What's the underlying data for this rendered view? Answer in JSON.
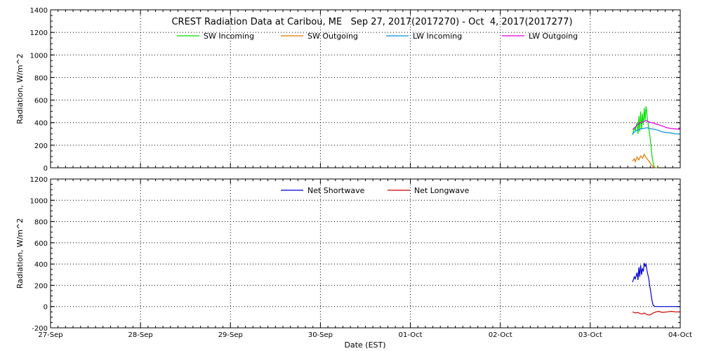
{
  "title": "CREST Radiation Data at Caribou, ME   Sep 27, 2017(2017270) - Oct  4, 2017(2017277)",
  "xlabel": "Date (EST)",
  "x_ticks": [
    "27-Sep",
    "28-Sep",
    "29-Sep",
    "30-Sep",
    "01-Oct",
    "02-Oct",
    "03-Oct",
    "04-Oct"
  ],
  "colors": {
    "sw_in": "#00dd00",
    "sw_out": "#e07800",
    "lw_in": "#0090e0",
    "lw_out": "#e000e0",
    "net_sw": "#0000cc",
    "net_lw": "#cc0000"
  },
  "chart_data": [
    {
      "type": "line",
      "ylabel": "Radiation, W/m^2",
      "ylim": [
        0,
        1400
      ],
      "y_ticks": [
        0,
        200,
        400,
        600,
        800,
        1000,
        1200,
        1400
      ],
      "xlim_days": [
        0,
        7
      ],
      "grid": true,
      "legend": "top",
      "series": [
        {
          "name": "SW Incoming",
          "color_key": "sw_in",
          "x": [
            6.47,
            6.49,
            6.5,
            6.52,
            6.53,
            6.54,
            6.55,
            6.56,
            6.57,
            6.58,
            6.59,
            6.6,
            6.61,
            6.62,
            6.63,
            6.64,
            6.65,
            6.66,
            6.67,
            6.68,
            6.69,
            6.7,
            6.71,
            6.72,
            6.73,
            6.74,
            6.75
          ],
          "values": [
            290,
            360,
            330,
            400,
            300,
            460,
            320,
            500,
            340,
            480,
            380,
            530,
            420,
            545,
            470,
            400,
            350,
            300,
            230,
            150,
            80,
            40,
            10,
            5,
            0,
            0,
            0
          ]
        },
        {
          "name": "SW Outgoing",
          "color_key": "sw_out",
          "x": [
            6.47,
            6.49,
            6.5,
            6.52,
            6.54,
            6.56,
            6.58,
            6.6,
            6.62,
            6.64,
            6.66,
            6.68,
            6.7,
            6.72,
            6.74
          ],
          "values": [
            60,
            80,
            55,
            95,
            70,
            105,
            85,
            120,
            90,
            70,
            50,
            25,
            10,
            0,
            0
          ]
        },
        {
          "name": "LW Incoming",
          "color_key": "lw_in",
          "x": [
            6.47,
            6.5,
            6.53,
            6.56,
            6.6,
            6.63,
            6.66,
            6.7,
            6.73,
            6.76,
            6.8,
            6.85,
            6.9,
            6.95,
            7.0
          ],
          "values": [
            300,
            325,
            335,
            345,
            350,
            355,
            348,
            342,
            340,
            330,
            318,
            312,
            308,
            300,
            300
          ]
        },
        {
          "name": "LW Outgoing",
          "color_key": "lw_out",
          "x": [
            6.47,
            6.49,
            6.5,
            6.52,
            6.54,
            6.56,
            6.58,
            6.6,
            6.62,
            6.64,
            6.66,
            6.68,
            6.7,
            6.72,
            6.75,
            6.78,
            6.8,
            6.85,
            6.9,
            6.95,
            7.0
          ],
          "values": [
            340,
            350,
            360,
            380,
            390,
            400,
            405,
            410,
            420,
            410,
            405,
            398,
            398,
            390,
            385,
            375,
            370,
            355,
            348,
            345,
            340
          ]
        }
      ]
    },
    {
      "type": "line",
      "ylabel": "Radiation, W/m^2",
      "ylim": [
        -200,
        1200
      ],
      "y_ticks": [
        -200,
        0,
        200,
        400,
        600,
        800,
        1000,
        1200
      ],
      "xlim_days": [
        0,
        7
      ],
      "grid": true,
      "legend": "top",
      "series": [
        {
          "name": "Net Shortwave",
          "color_key": "net_sw",
          "x": [
            6.47,
            6.49,
            6.5,
            6.52,
            6.53,
            6.54,
            6.55,
            6.56,
            6.57,
            6.58,
            6.59,
            6.6,
            6.61,
            6.62,
            6.63,
            6.64,
            6.65,
            6.66,
            6.67,
            6.68,
            6.69,
            6.7,
            6.72,
            6.75,
            6.8,
            6.9,
            7.0
          ],
          "values": [
            230,
            280,
            260,
            320,
            250,
            370,
            280,
            390,
            300,
            360,
            330,
            410,
            380,
            400,
            340,
            300,
            260,
            200,
            150,
            90,
            40,
            10,
            0,
            0,
            0,
            0,
            0
          ]
        },
        {
          "name": "Net Longwave",
          "color_key": "net_lw",
          "x": [
            6.47,
            6.5,
            6.53,
            6.55,
            6.58,
            6.6,
            6.63,
            6.66,
            6.7,
            6.73,
            6.76,
            6.8,
            6.85,
            6.9,
            6.95,
            7.0
          ],
          "values": [
            -50,
            -60,
            -55,
            -65,
            -70,
            -60,
            -75,
            -80,
            -60,
            -50,
            -45,
            -55,
            -50,
            -45,
            -50,
            -50
          ]
        }
      ]
    }
  ]
}
